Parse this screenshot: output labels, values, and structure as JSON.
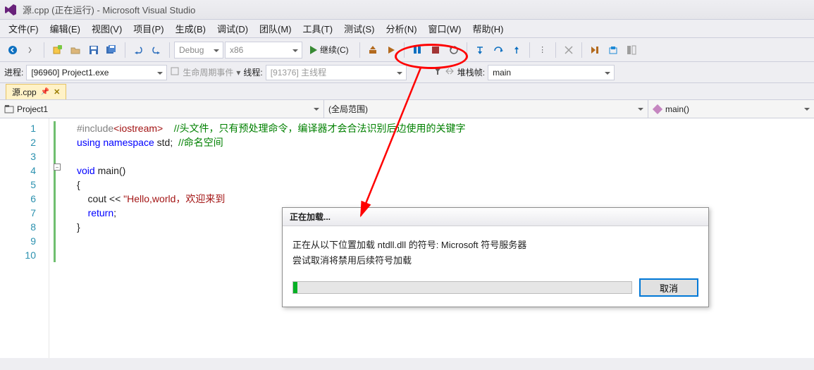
{
  "title": "源.cpp (正在运行) - Microsoft Visual Studio",
  "menu": [
    "文件(F)",
    "编辑(E)",
    "视图(V)",
    "项目(P)",
    "生成(B)",
    "调试(D)",
    "团队(M)",
    "工具(T)",
    "测试(S)",
    "分析(N)",
    "窗口(W)",
    "帮助(H)"
  ],
  "toolbar": {
    "config": "Debug",
    "platform": "x86",
    "continue": "继续(C)"
  },
  "toolbar2": {
    "process_label": "进程:",
    "process_value": "[96960] Project1.exe",
    "lifecycle_label": "生命周期事件",
    "thread_label": "线程:",
    "thread_value": "[91376] 主线程",
    "stackframe_label": "堆栈帧:",
    "stackframe_value": "main"
  },
  "tab": {
    "name": "源.cpp"
  },
  "nav": {
    "project": "Project1",
    "scope": "(全局范围)",
    "member": "main()"
  },
  "code": {
    "lines": [
      {
        "n": "1",
        "html": "<span class='inc'>#include</span><span class='incarg'>&lt;iostream&gt;</span>    <span class='cm'>//头文件，只有预处理命令，编译器才会合法识别后边使用的关键字</span>"
      },
      {
        "n": "2",
        "html": "<span class='kw'>using namespace</span> std;  <span class='cm'>//命名空间</span>"
      },
      {
        "n": "3",
        "html": ""
      },
      {
        "n": "4",
        "html": "<span class='kw'>void</span> main()"
      },
      {
        "n": "5",
        "html": "{"
      },
      {
        "n": "6",
        "html": "    cout &lt;&lt; <span class='str'>\"Hello,world，欢迎来到</span>"
      },
      {
        "n": "7",
        "html": "    <span class='kw'>return</span>;"
      },
      {
        "n": "8",
        "html": "}"
      },
      {
        "n": "9",
        "html": ""
      },
      {
        "n": "10",
        "html": ""
      }
    ]
  },
  "dialog": {
    "title": "正在加载...",
    "msg1": "正在从以下位置加载 ntdll.dll 的符号: Microsoft 符号服务器",
    "msg2": "尝试取消将禁用后续符号加载",
    "cancel": "取消"
  }
}
